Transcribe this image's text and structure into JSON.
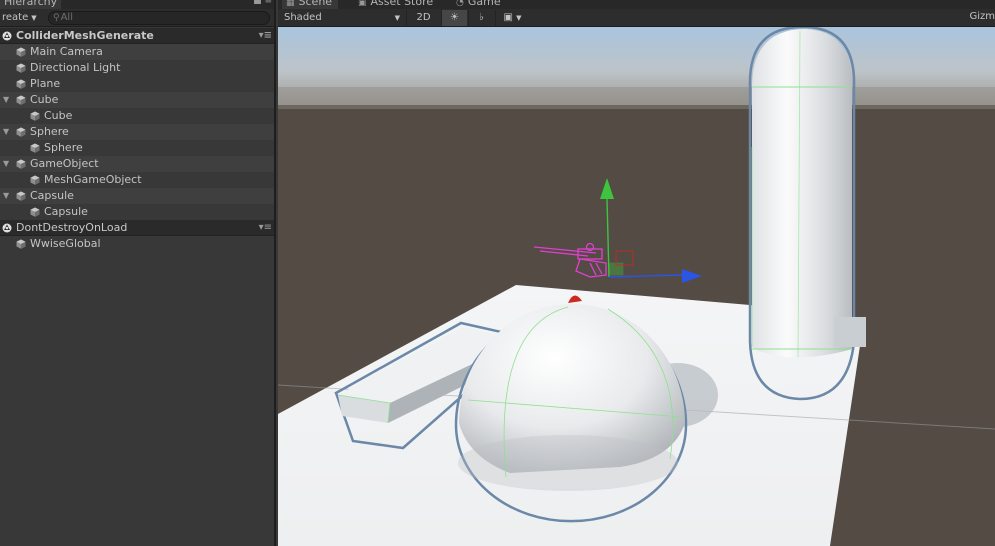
{
  "hierarchy": {
    "tab_label": "Hierarchy",
    "create_label": "reate",
    "search_placeholder": "All",
    "scene_name": "ColliderMeshGenerate",
    "items": [
      {
        "label": "Main Camera"
      },
      {
        "label": "Directional Light"
      },
      {
        "label": "Plane"
      },
      {
        "label": "Cube"
      },
      {
        "label": "Cube"
      },
      {
        "label": "Sphere"
      },
      {
        "label": "Sphere"
      },
      {
        "label": "GameObject"
      },
      {
        "label": "MeshGameObject"
      },
      {
        "label": "Capsule"
      },
      {
        "label": "Capsule"
      }
    ],
    "dont_destroy_label": "DontDestroyOnLoad",
    "wwise_label": "WwiseGlobal"
  },
  "scene_tabs": {
    "scene": "Scene",
    "asset_store": "Asset Store",
    "game": "Game"
  },
  "scene_toolbar": {
    "shading_mode": "Shaded",
    "mode_2d": "2D",
    "gizmos": "Gizm"
  },
  "icons": {
    "cube": "cube-icon",
    "unity": "unity-logo-icon",
    "light": "sun-icon",
    "audio": "speaker-icon",
    "image": "image-icon"
  },
  "colors": {
    "panel_bg": "#383838",
    "scene_row_bg": "#2a2a2a",
    "sky_top": "#a6c2dc",
    "ground": "#544c45",
    "selection_outline": "#6b88a8",
    "gizmo_x": "#2a55e5",
    "gizmo_y": "#3ec43e",
    "gizmo_z": "#cc2a1e",
    "camera_magenta": "#e040d0"
  }
}
